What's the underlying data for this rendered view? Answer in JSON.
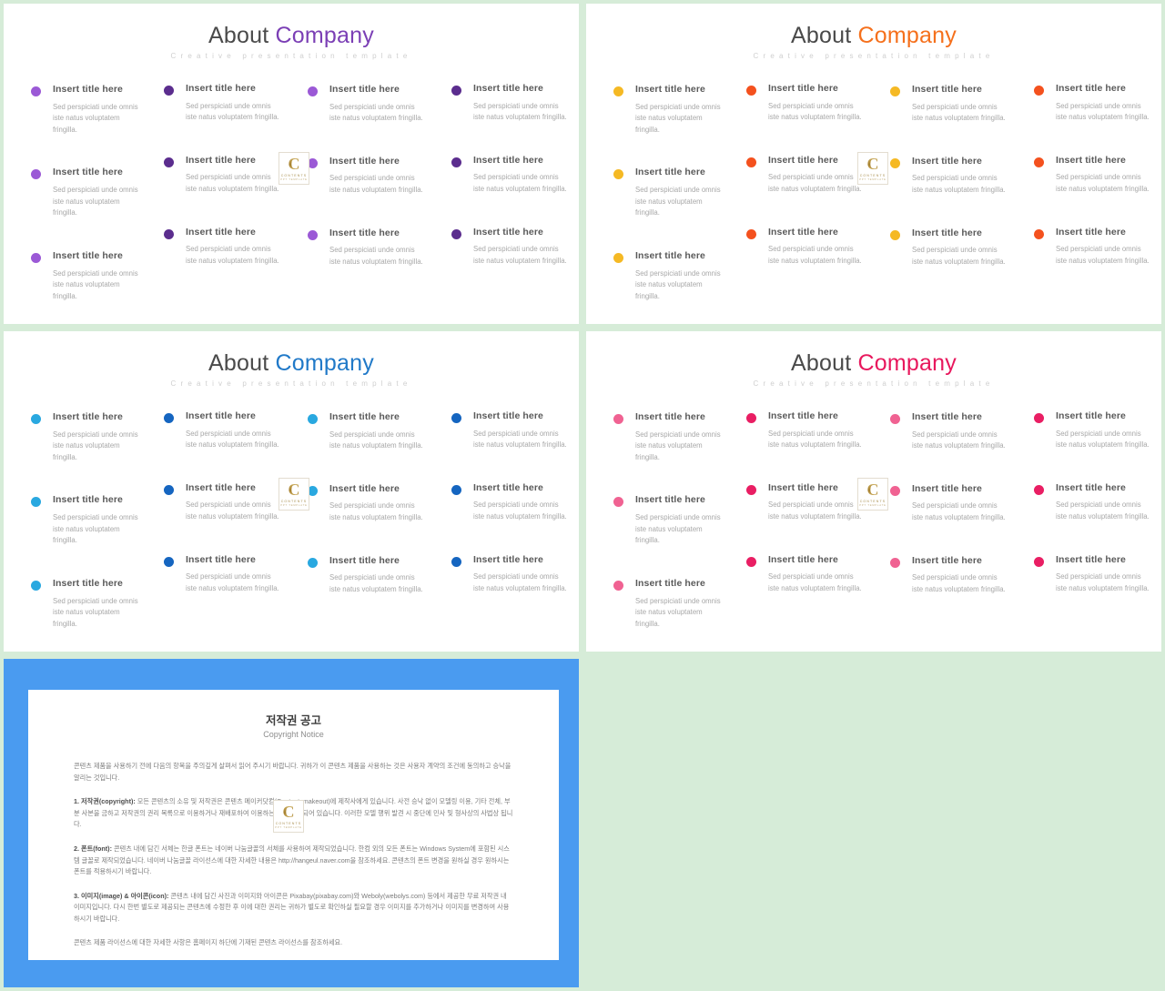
{
  "page": {
    "background_color": "#d6ecd8"
  },
  "slides": [
    {
      "id": "slide-purple",
      "title_first": "About",
      "title_second": "Company",
      "title_first_color": "#4a4a4a",
      "title_second_color": "#7b3fb5",
      "subtitle": "Creative presentation template",
      "dot_colors": [
        "#9b59d6",
        "#5b2d8e",
        "#9b59d6",
        "#5b2d8e"
      ],
      "columns": [
        [
          {
            "title": "Insert title here",
            "desc": "Sed perspiciati unde omnis iste natus voluptatem fringilla."
          },
          {
            "title": "Insert title here",
            "desc": "Sed perspiciati unde omnis iste natus voluptatem fringilla."
          },
          {
            "title": "Insert title here",
            "desc": "Sed perspiciati unde omnis iste natus voluptatem fringilla."
          }
        ],
        [
          {
            "title": "Insert title here",
            "desc": "Sed perspiciati unde omnis iste natus voluptatem fringilla."
          },
          {
            "title": "Insert title here",
            "desc": "Sed perspiciati unde omnis iste natus voluptatem fringilla."
          },
          {
            "title": "Insert title here",
            "desc": "Sed perspiciati unde omnis iste natus voluptatem fringilla."
          }
        ],
        [
          {
            "title": "Insert title here",
            "desc": "Sed perspiciati unde omnis iste natus voluptatem fringilla."
          },
          {
            "title": "Insert title here",
            "desc": "Sed perspiciati unde omnis iste natus voluptatem fringilla."
          },
          {
            "title": "Insert title here",
            "desc": "Sed perspiciati unde omnis iste natus voluptatem fringilla."
          }
        ],
        [
          {
            "title": "Insert title here",
            "desc": "Sed perspiciati unde omnis iste natus voluptatem fringilla."
          },
          {
            "title": "Insert title here",
            "desc": "Sed perspiciati unde omnis iste natus voluptatem fringilla."
          },
          {
            "title": "Insert title here",
            "desc": "Sed perspiciati unde omnis iste natus voluptatem fringilla."
          }
        ]
      ]
    },
    {
      "id": "slide-orange",
      "title_first": "About",
      "title_second": "Company",
      "title_first_color": "#4a4a4a",
      "title_second_color": "#f5701c",
      "subtitle": "Creative presentation template",
      "dot_colors": [
        "#f5b924",
        "#f4511e",
        "#f5b924",
        "#f4511e"
      ],
      "columns": [
        [
          {
            "title": "Insert title here",
            "desc": "Sed perspiciati unde omnis iste natus voluptatem fringilla."
          },
          {
            "title": "Insert title here",
            "desc": "Sed perspiciati unde omnis iste natus voluptatem fringilla."
          },
          {
            "title": "Insert title here",
            "desc": "Sed perspiciati unde omnis iste natus voluptatem fringilla."
          }
        ],
        [
          {
            "title": "Insert title here",
            "desc": "Sed perspiciati unde omnis iste natus voluptatem fringilla."
          },
          {
            "title": "Insert title here",
            "desc": "Sed perspiciati unde omnis iste natus voluptatem fringilla."
          },
          {
            "title": "Insert title here",
            "desc": "Sed perspiciati unde omnis iste natus voluptatem fringilla."
          }
        ],
        [
          {
            "title": "Insert title here",
            "desc": "Sed perspiciati unde omnis iste natus voluptatem fringilla."
          },
          {
            "title": "Insert title here",
            "desc": "Sed perspiciati unde omnis iste natus voluptatem fringilla."
          },
          {
            "title": "Insert title here",
            "desc": "Sed perspiciati unde omnis iste natus voluptatem fringilla."
          }
        ],
        [
          {
            "title": "Insert title here",
            "desc": "Sed perspiciati unde omnis iste natus voluptatem fringilla."
          },
          {
            "title": "Insert title here",
            "desc": "Sed perspiciati unde omnis iste natus voluptatem fringilla."
          },
          {
            "title": "Insert title here",
            "desc": "Sed perspiciati unde omnis iste natus voluptatem fringilla."
          }
        ]
      ]
    },
    {
      "id": "slide-blue",
      "title_first": "About",
      "title_second": "Company",
      "title_first_color": "#4a4a4a",
      "title_second_color": "#2079c8",
      "subtitle": "Creative presentation template",
      "dot_colors": [
        "#29a8e0",
        "#1565c0",
        "#29a8e0",
        "#1565c0"
      ],
      "columns": [
        [
          {
            "title": "Insert title here",
            "desc": "Sed perspiciati unde omnis iste natus voluptatem fringilla."
          },
          {
            "title": "Insert title here",
            "desc": "Sed perspiciati unde omnis iste natus voluptatem fringilla."
          },
          {
            "title": "Insert title here",
            "desc": "Sed perspiciati unde omnis iste natus voluptatem fringilla."
          }
        ],
        [
          {
            "title": "Insert title here",
            "desc": "Sed perspiciati unde omnis iste natus voluptatem fringilla."
          },
          {
            "title": "Insert title here",
            "desc": "Sed perspiciati unde omnis iste natus voluptatem fringilla."
          },
          {
            "title": "Insert title here",
            "desc": "Sed perspiciati unde omnis iste natus voluptatem fringilla."
          }
        ],
        [
          {
            "title": "Insert title here",
            "desc": "Sed perspiciati unde omnis iste natus voluptatem fringilla."
          },
          {
            "title": "Insert title here",
            "desc": "Sed perspiciati unde omnis iste natus voluptatem fringilla."
          },
          {
            "title": "Insert title here",
            "desc": "Sed perspiciati unde omnis iste natus voluptatem fringilla."
          }
        ],
        [
          {
            "title": "Insert title here",
            "desc": "Sed perspiciati unde omnis iste natus voluptatem fringilla."
          },
          {
            "title": "Insert title here",
            "desc": "Sed perspiciati unde omnis iste natus voluptatem fringilla."
          },
          {
            "title": "Insert title here",
            "desc": "Sed perspiciati unde omnis iste natus voluptatem fringilla."
          }
        ]
      ]
    },
    {
      "id": "slide-pink",
      "title_first": "About",
      "title_second": "Company",
      "title_first_color": "#4a4a4a",
      "title_second_color": "#e8185d",
      "subtitle": "Creative presentation template",
      "dot_colors": [
        "#f06292",
        "#e91e63",
        "#f06292",
        "#e91e63"
      ],
      "columns": [
        [
          {
            "title": "Insert title here",
            "desc": "Sed perspiciati unde omnis iste natus voluptatem fringilla."
          },
          {
            "title": "Insert title here",
            "desc": "Sed perspiciati unde omnis iste natus voluptatem fringilla."
          },
          {
            "title": "Insert title here",
            "desc": "Sed perspiciati unde omnis iste natus voluptatem fringilla."
          }
        ],
        [
          {
            "title": "Insert title here",
            "desc": "Sed perspiciati unde omnis iste natus voluptatem fringilla."
          },
          {
            "title": "Insert title here",
            "desc": "Sed perspiciati unde omnis iste natus voluptatem fringilla."
          },
          {
            "title": "Insert title here",
            "desc": "Sed perspiciati unde omnis iste natus voluptatem fringilla."
          }
        ],
        [
          {
            "title": "Insert title here",
            "desc": "Sed perspiciati unde omnis iste natus voluptatem fringilla."
          },
          {
            "title": "Insert title here",
            "desc": "Sed perspiciati unde omnis iste natus voluptatem fringilla."
          },
          {
            "title": "Insert title here",
            "desc": "Sed perspiciati unde omnis iste natus voluptatem fringilla."
          }
        ],
        [
          {
            "title": "Insert title here",
            "desc": "Sed perspiciati unde omnis iste natus voluptatem fringilla."
          },
          {
            "title": "Insert title here",
            "desc": "Sed perspiciati unde omnis iste natus voluptatem fringilla."
          },
          {
            "title": "Insert title here",
            "desc": "Sed perspiciati unde omnis iste natus voluptatem fringilla."
          }
        ]
      ]
    }
  ],
  "logo": {
    "letter": "C",
    "word": "CONTENTS",
    "tagline": "PPT TEMPLATE"
  },
  "copyright_slide": {
    "frame_color": "#4a9bf0",
    "title_ko": "저작권 공고",
    "title_en": "Copyright Notice",
    "intro": "콘텐츠 제품을 사용하기 전에 다음의 항목을 주의깊게 살펴서 읽어 주시기 바랍니다. 귀하가 이 콘텐츠 제품을 사용하는 것은 사용자 계약의 조건에 동의하고 승낙을 알리는 것입니다.",
    "item1_label": "1. 저작권(copyright):",
    "item1_text": "모든 콘텐츠의 소유 및 저작권은 콘텐츠 메이커닷컴(Contentsmakeout)에 제작사에게 있습니다. 사전 승낙 없이 모델링 이용, 기타 전체, 부분 사본을 금하고 저작권의 권리 목록으로 이용하거나 재배포하여 이용하는 것은 금지되어 있습니다. 이러한 모델 행위 발견 시 중단에 민사 및 형사상의 사법상 됩니다.",
    "item2_label": "2. 폰트(font):",
    "item2_text": "콘텐츠 내에 담긴 서체는 한글 폰트는 네이버 나눔글꼴의 서체를 사용하여 제작되었습니다. 한컴 외의 모든 폰트는 Windows System에 포함된 시스템 글꼴로 제작되었습니다. 네이버 나눔글꼴 라이선스에 대한 자세한 내용은 http://hangeul.naver.com을 참조하세요. 콘텐츠의 폰트 변경을 원하실 경우 원하시는 폰트를 적용하시기 바랍니다.",
    "item3_label": "3. 이미지(image) & 아이콘(icon):",
    "item3_text": "콘텐츠 내에 담긴 사진과 이미지와 아이콘은 Pixabay(pixabay.com)와 Weboly(webolys.com) 등에서 제공한 무료 저작권 내 이미지입니다. 다시 한번 별도로 제공되는 콘텐츠에 수정한 후 이에 대한 권리는 귀하가 별도로 확인하실 필요할 경우 이미지를 추가하거나 이미지를 변경하여 사용하시기 바랍니다.",
    "footer": "콘텐츠 제품 라이선스에 대한 자세한 사항은 홈페이지 하단에 기재된 콘텐츠 라이선스를 참조하세요."
  }
}
